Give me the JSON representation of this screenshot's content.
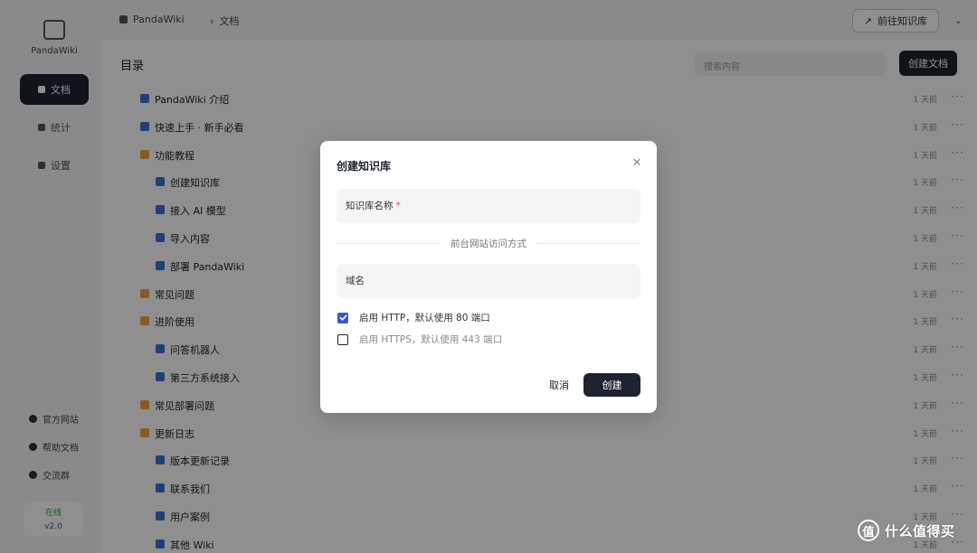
{
  "sidebar": {
    "brand": "PandaWiki",
    "nav": [
      {
        "label": "文档",
        "active": true
      },
      {
        "label": "统计",
        "active": false
      },
      {
        "label": "设置",
        "active": false
      }
    ],
    "links": [
      "官方网站",
      "帮助文档",
      "交流群"
    ],
    "status": {
      "state": "在线",
      "version": "v2.0"
    }
  },
  "topbar": {
    "breadcrumb": [
      "PandaWiki",
      "文档"
    ],
    "button_label": "前往知识库"
  },
  "content": {
    "title": "目录",
    "search_placeholder": "搜索内容",
    "create_label": "创建文档",
    "rows": [
      {
        "type": "doc",
        "indent": 0,
        "label": "PandaWiki 介绍",
        "meta": "1 天前"
      },
      {
        "type": "doc",
        "indent": 0,
        "label": "快速上手 · 新手必看",
        "meta": "1 天前"
      },
      {
        "type": "folder",
        "indent": 0,
        "label": "功能教程",
        "meta": "1 天前"
      },
      {
        "type": "doc",
        "indent": 1,
        "label": "创建知识库",
        "meta": "1 天前"
      },
      {
        "type": "doc",
        "indent": 1,
        "label": "接入 AI 模型",
        "meta": "1 天前"
      },
      {
        "type": "doc",
        "indent": 1,
        "label": "导入内容",
        "meta": "1 天前"
      },
      {
        "type": "doc",
        "indent": 1,
        "label": "部署 PandaWiki",
        "meta": "1 天前"
      },
      {
        "type": "folder",
        "indent": 0,
        "label": "常见问题",
        "meta": "1 天前"
      },
      {
        "type": "folder",
        "indent": 0,
        "label": "进阶使用",
        "meta": "1 天前"
      },
      {
        "type": "doc",
        "indent": 1,
        "label": "问答机器人",
        "meta": "1 天前"
      },
      {
        "type": "doc",
        "indent": 1,
        "label": "第三方系统接入",
        "meta": "1 天前"
      },
      {
        "type": "folder",
        "indent": 0,
        "label": "常见部署问题",
        "meta": "1 天前"
      },
      {
        "type": "folder",
        "indent": 0,
        "label": "更新日志",
        "meta": "1 天前"
      },
      {
        "type": "doc",
        "indent": 1,
        "label": "版本更新记录",
        "meta": "1 天前"
      },
      {
        "type": "doc",
        "indent": 1,
        "label": "联系我们",
        "meta": "1 天前"
      },
      {
        "type": "doc",
        "indent": 1,
        "label": "用户案例",
        "meta": "1 天前"
      },
      {
        "type": "doc",
        "indent": 1,
        "label": "其他 Wiki",
        "meta": "1 天前"
      }
    ]
  },
  "modal": {
    "title": "创建知识库",
    "name_field": {
      "label": "知识库名称",
      "required_mark": "*"
    },
    "divider_label": "前台网站访问方式",
    "domain_field": {
      "label": "域名"
    },
    "options": [
      {
        "label": "启用 HTTP，默认使用 80 端口",
        "checked": true
      },
      {
        "label": "启用 HTTPS，默认使用 443 端口",
        "checked": false
      }
    ],
    "cancel_label": "取消",
    "confirm_label": "创建"
  },
  "watermark": {
    "logo_char": "值",
    "text": "什么值得买"
  },
  "colors": {
    "primary": "#1f2330",
    "checkbox": "#3756d4",
    "required": "#e54848"
  }
}
